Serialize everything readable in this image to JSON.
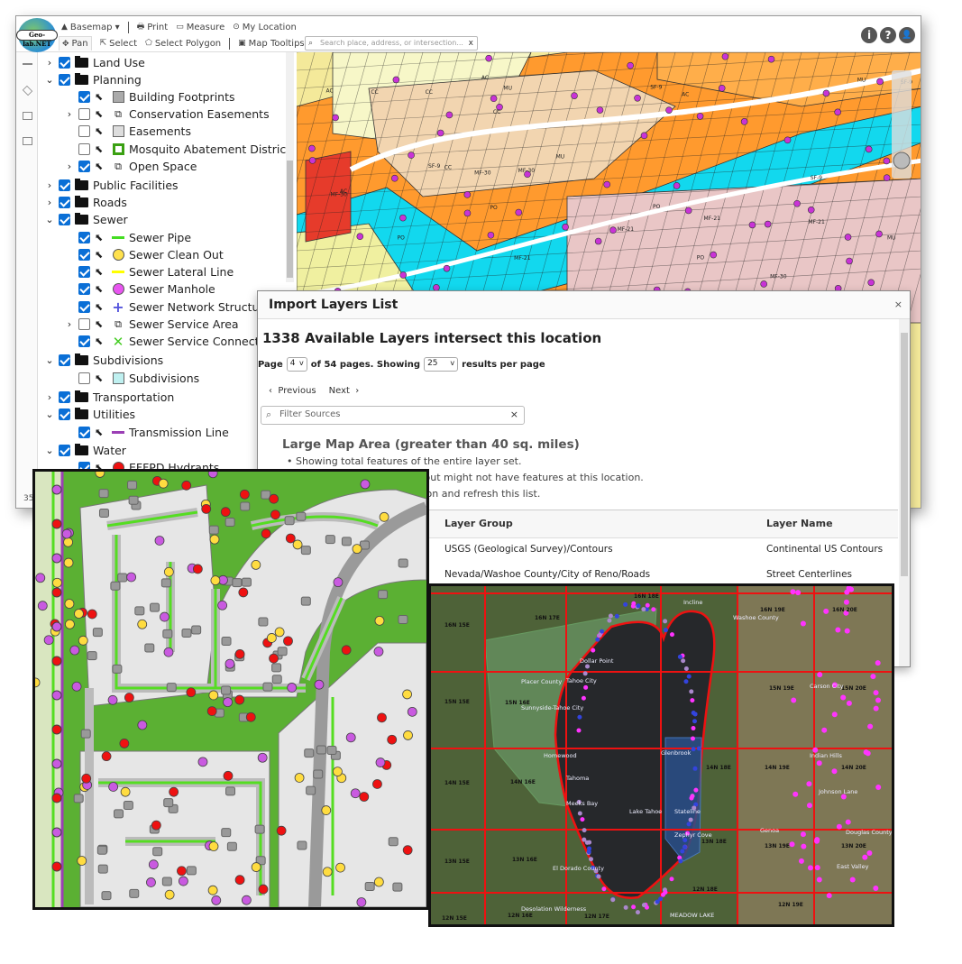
{
  "app": {
    "logo_text": "Geo-lab.NET"
  },
  "toolbar": {
    "row1": [
      {
        "icon": "mountain-icon",
        "label": "Basemap ▾"
      },
      {
        "icon": "printer-icon",
        "label": "Print"
      },
      {
        "icon": "ruler-icon",
        "label": "Measure"
      },
      {
        "icon": "crosshair-icon",
        "label": "My Location"
      }
    ],
    "row2": [
      {
        "icon": "move-icon",
        "label": "Pan"
      },
      {
        "icon": "cursor-icon",
        "label": "Select"
      },
      {
        "icon": "polygon-icon",
        "label": "Select Polygon"
      },
      {
        "icon": "comment-icon",
        "label": "Map Tooltips"
      }
    ],
    "search_placeholder": "Search place, address, or intersection...",
    "search_clear": "x"
  },
  "header_icons": [
    {
      "icon": "info-icon",
      "glyph": "i"
    },
    {
      "icon": "help-icon",
      "glyph": "?"
    },
    {
      "icon": "user-icon",
      "glyph": "👤"
    }
  ],
  "layer_tree": [
    {
      "level": 0,
      "expand": ">",
      "checked": true,
      "type": "folder",
      "label": "Land Use"
    },
    {
      "level": 0,
      "expand": "v",
      "checked": true,
      "type": "folder",
      "label": "Planning"
    },
    {
      "level": 1,
      "expand": "",
      "checked": true,
      "type": "fill",
      "color": "#aaaaaa",
      "label": "Building Footprints"
    },
    {
      "level": 1,
      "expand": ">",
      "checked": false,
      "type": "group",
      "label": "Conservation Easements"
    },
    {
      "level": 1,
      "expand": "",
      "checked": false,
      "type": "fill",
      "color": "#dddddd",
      "label": "Easements"
    },
    {
      "level": 1,
      "expand": "",
      "checked": false,
      "type": "outline",
      "color": "#3aa012",
      "label": "Mosquito Abatement District"
    },
    {
      "level": 1,
      "expand": ">",
      "checked": true,
      "type": "group",
      "label": "Open Space"
    },
    {
      "level": 0,
      "expand": ">",
      "checked": true,
      "type": "folder",
      "label": "Public Facilities"
    },
    {
      "level": 0,
      "expand": ">",
      "checked": true,
      "type": "folder",
      "label": "Roads"
    },
    {
      "level": 0,
      "expand": "v",
      "checked": true,
      "type": "folder",
      "label": "Sewer"
    },
    {
      "level": 1,
      "expand": "",
      "checked": true,
      "type": "line",
      "color": "#44dd22",
      "label": "Sewer Pipe"
    },
    {
      "level": 1,
      "expand": "",
      "checked": true,
      "type": "circle",
      "color": "#ffe14d",
      "label": "Sewer Clean Out"
    },
    {
      "level": 1,
      "expand": "",
      "checked": true,
      "type": "line",
      "color": "#ffff00",
      "label": "Sewer Lateral Line"
    },
    {
      "level": 1,
      "expand": "",
      "checked": true,
      "type": "circle",
      "color": "#e855f0",
      "label": "Sewer Manhole"
    },
    {
      "level": 1,
      "expand": "",
      "checked": true,
      "type": "plus",
      "color": "#5555dd",
      "label": "Sewer Network Structure"
    },
    {
      "level": 1,
      "expand": ">",
      "checked": false,
      "type": "group",
      "label": "Sewer Service Area"
    },
    {
      "level": 1,
      "expand": "",
      "checked": true,
      "type": "x",
      "color": "#44cc22",
      "label": "Sewer Service Connection"
    },
    {
      "level": 0,
      "expand": "v",
      "checked": true,
      "type": "folder",
      "label": "Subdivisions"
    },
    {
      "level": 1,
      "expand": "",
      "checked": false,
      "type": "fill",
      "color": "#bff0f0",
      "label": "Subdivisions"
    },
    {
      "level": 0,
      "expand": ">",
      "checked": true,
      "type": "folder",
      "label": "Transportation"
    },
    {
      "level": 0,
      "expand": "v",
      "checked": true,
      "type": "folder",
      "label": "Utilities"
    },
    {
      "level": 1,
      "expand": "",
      "checked": true,
      "type": "line",
      "color": "#9b3fb5",
      "label": "Transmission Line"
    },
    {
      "level": 0,
      "expand": "v",
      "checked": true,
      "type": "folder",
      "label": "Water"
    },
    {
      "level": 1,
      "expand": "",
      "checked": true,
      "type": "circle",
      "color": "#ee1111",
      "label": "EFFPD Hydrants"
    }
  ],
  "status_text": "35",
  "dialog": {
    "title": "Import Layers List",
    "close": "×",
    "heading": "1338 Available Layers intersect this location",
    "page_label": "Page",
    "page_value": "4",
    "of_pages": "of 54 pages. Showing",
    "per_page_value": "25",
    "per_page_suffix": "results per page",
    "previous": "Previous",
    "next": "Next",
    "filter_placeholder": "Filter Sources",
    "large_area_title": "Large Map Area (greater than 40 sq. miles)",
    "notes": [
      "• Showing total features of the entire layer set.",
      "ect your current map view, but might not have features at this location.",
      "t view, zoom to a new location and refresh this list."
    ],
    "columns": [
      "Layer Group",
      "Layer Name"
    ],
    "rows": [
      [
        "USGS (Geological Survey)/Contours",
        "Continental US Contours"
      ],
      [
        "Nevada/Washoe County/City of Reno/Roads",
        "Street Centerlines"
      ]
    ]
  },
  "lake_map": {
    "labels": [
      "16N 15E",
      "16N 17E",
      "16N 18E",
      "16N 19E",
      "16N 20E",
      "15N 15E",
      "15N 16E",
      "15N 19E",
      "15N 20E",
      "14N 15E",
      "14N 16E",
      "14N 18E",
      "14N 19E",
      "14N 20E",
      "13N 15E",
      "13N 16E",
      "13N 18E",
      "13N 19E",
      "13N 20E",
      "12N 15E",
      "12N 16E",
      "12N 17E",
      "12N 18E",
      "12N 19E",
      "Lake Tahoe",
      "Carson City",
      "Tahoe City",
      "Sunnyside-Tahoe City",
      "Homewood",
      "Tahoma",
      "Meeks Bay",
      "Glenbrook",
      "Stateline",
      "Zephyr Cove",
      "Genoa",
      "Indian Hills",
      "Johnson Lane",
      "East Valley",
      "Placer County",
      "Washoe County",
      "Douglas County",
      "El Dorado County",
      "Dollar Point",
      "Incline",
      "Desolation Wilderness",
      "MEADOW LAKE"
    ]
  },
  "map_zone_labels": [
    "MU",
    "CC",
    "AC",
    "MF-30",
    "SF-9",
    "PO",
    "MF-21"
  ]
}
